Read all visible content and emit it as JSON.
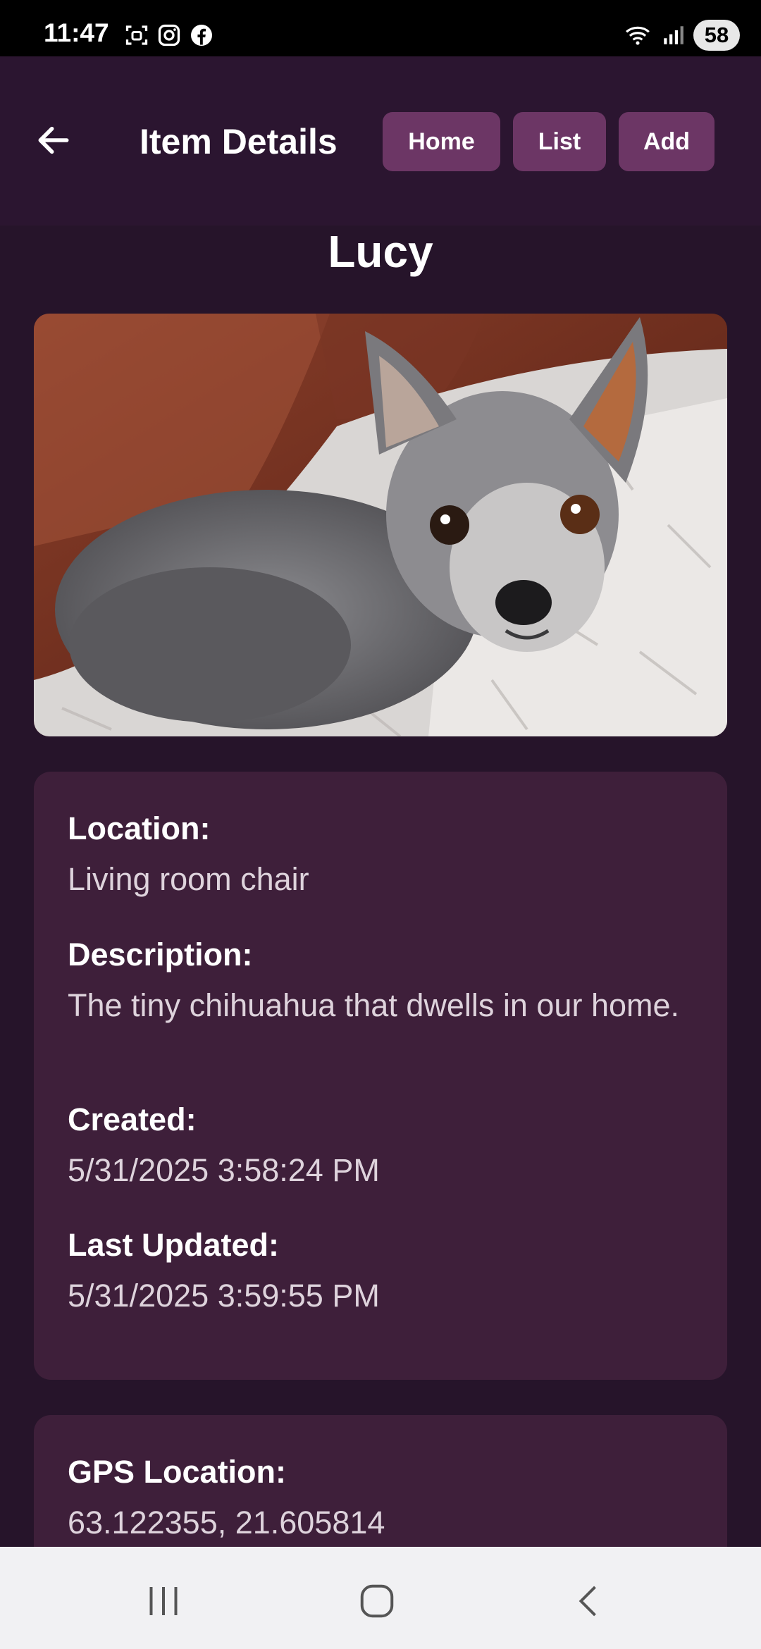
{
  "status": {
    "time": "11:47",
    "battery": "58",
    "icons": [
      "screenshot-icon",
      "instagram-icon",
      "facebook-icon",
      "wifi-icon",
      "signal-icon"
    ]
  },
  "appbar": {
    "title": "Item Details",
    "buttons": {
      "home": "Home",
      "list": "List",
      "add": "Add"
    }
  },
  "item": {
    "name": "Lucy",
    "photo_alt": "dog-photo",
    "fields": {
      "location_label": "Location:",
      "location_value": "Living room chair",
      "description_label": "Description:",
      "description_value": "The tiny chihuahua that dwells in our home.",
      "created_label": "Created:",
      "created_value": "5/31/2025 3:58:24 PM",
      "updated_label": "Last Updated:",
      "updated_value": "5/31/2025 3:59:55 PM"
    },
    "gps": {
      "label": "GPS Location:",
      "value": "63.122355, 21.605814"
    }
  },
  "colors": {
    "background": "#26142a",
    "appbar": "#2b1530",
    "button": "#6c3665",
    "card": "#3e1f3a"
  }
}
